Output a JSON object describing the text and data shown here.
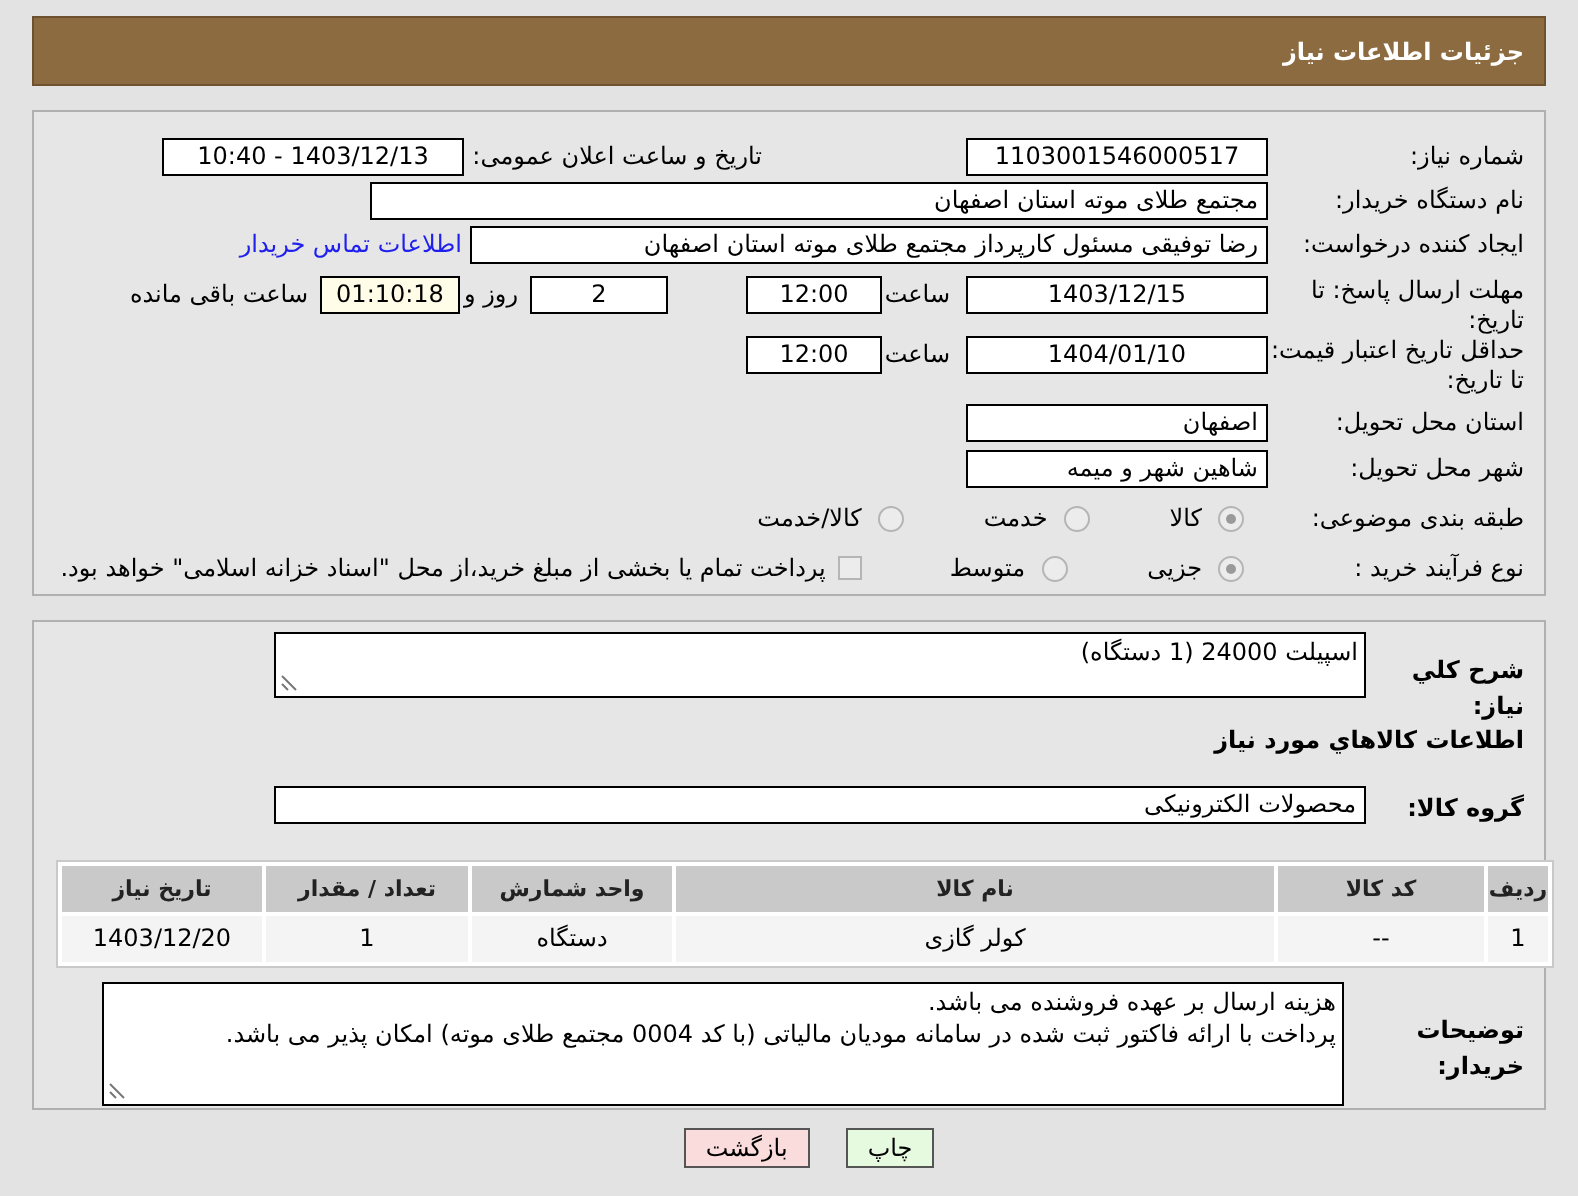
{
  "header": {
    "title": "جزئیات اطلاعات نیاز"
  },
  "need_number": {
    "label": "شماره نیاز:",
    "value": "1103001546000517"
  },
  "announce": {
    "label": "تاریخ و ساعت اعلان عمومی:",
    "value": "1403/12/13 - 10:40"
  },
  "buyer_org": {
    "label": "نام دستگاه خریدار:",
    "value": "مجتمع طلای موته استان اصفهان"
  },
  "requester": {
    "label": "ایجاد کننده درخواست:",
    "value": "رضا توفیقی مسئول کارپرداز مجتمع طلای موته استان اصفهان",
    "link": "اطلاعات تماس خریدار"
  },
  "reply_deadline": {
    "label": "مهلت ارسال پاسخ: تا تاریخ:",
    "date": "1403/12/15",
    "time_label": "ساعت",
    "time": "12:00",
    "days": "2",
    "days_label": "روز و",
    "remaining": "01:10:18",
    "remaining_label": "ساعت باقی مانده"
  },
  "price_validity": {
    "label": "حداقل تاریخ اعتبار قیمت: تا تاریخ:",
    "date": "1404/01/10",
    "time_label": "ساعت",
    "time": "12:00"
  },
  "province": {
    "label": "استان محل تحویل:",
    "value": "اصفهان"
  },
  "city": {
    "label": "شهر محل تحویل:",
    "value": "شاهین شهر و میمه"
  },
  "category": {
    "label": "طبقه بندی موضوعی:",
    "options": [
      {
        "label": "کالا",
        "selected": true
      },
      {
        "label": "خدمت",
        "selected": false
      },
      {
        "label": "کالا/خدمت",
        "selected": false
      }
    ]
  },
  "purchase_type": {
    "label": "نوع فرآیند خرید :",
    "options": [
      {
        "label": "جزیی",
        "selected": true
      },
      {
        "label": "متوسط",
        "selected": false
      }
    ],
    "checkbox": {
      "label": "پرداخت تمام یا بخشی از مبلغ خرید،از محل \"اسناد خزانه اسلامی\" خواهد بود.",
      "checked": false
    }
  },
  "description": {
    "label": "شرح كلي نياز:",
    "value": "اسپیلت 24000 (1 دستگاه)"
  },
  "goods_title": "اطلاعات كالاهاي مورد نياز",
  "goods_group": {
    "label": "گروه کالا:",
    "value": "محصولات الکترونیکی"
  },
  "table": {
    "columns": [
      "ردیف",
      "کد کالا",
      "نام کالا",
      "واحد شمارش",
      "تعداد / مقدار",
      "تاریخ نیاز"
    ],
    "rows": [
      [
        "1",
        "--",
        "کولر گازی",
        "دستگاه",
        "1",
        "1403/12/20"
      ]
    ]
  },
  "buyer_notes": {
    "label": "توضیحات خریدار:",
    "lines": [
      "هزینه ارسال بر عهده فروشنده می باشد.",
      "پرداخت با ارائه فاکتور ثبت شده در سامانه مودیان مالیاتی (با کد 0004 مجتمع طلای موته) امکان پذیر می باشد."
    ]
  },
  "buttons": [
    {
      "label": "چاپ",
      "kind": "print"
    },
    {
      "label": "بازگشت",
      "kind": "back"
    }
  ]
}
